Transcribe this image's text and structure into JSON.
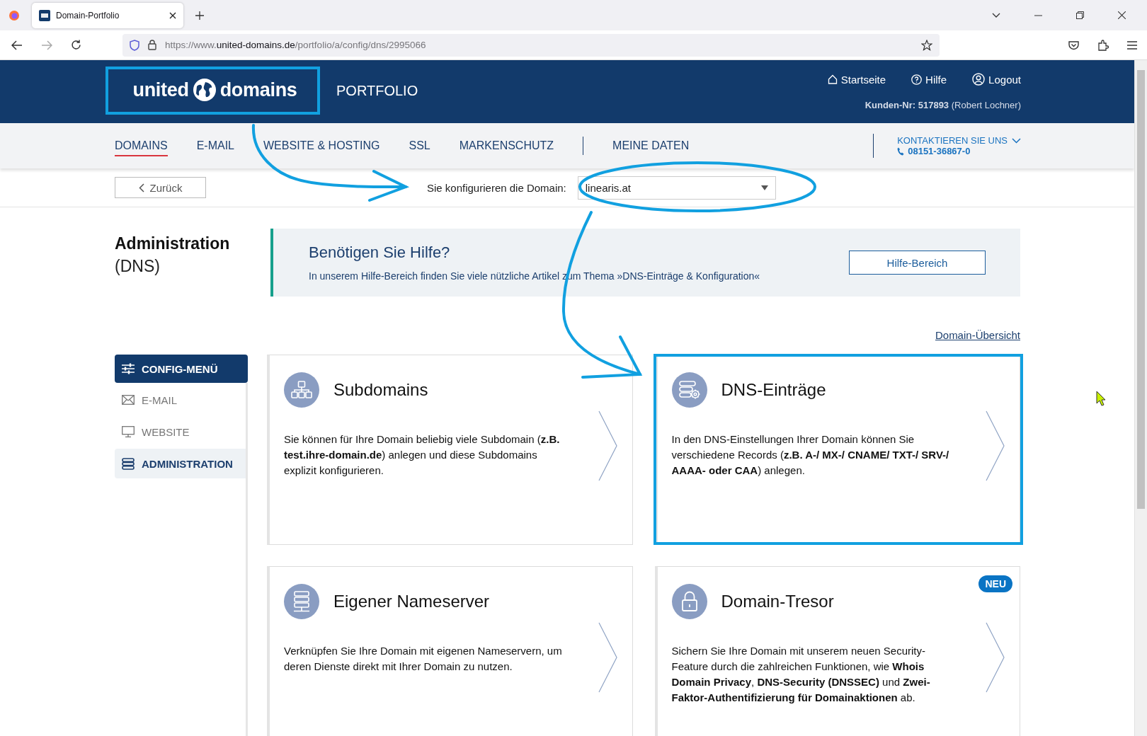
{
  "browser": {
    "tab_title": "Domain-Portfolio",
    "url_prefix": "https://www.",
    "url_host": "united-domains.de",
    "url_path": "/portfolio/a/config/dns/2995066"
  },
  "header": {
    "logo_left": "united",
    "logo_right": "domains",
    "section": "PORTFOLIO",
    "links": [
      {
        "label": "Startseite",
        "kind": "home"
      },
      {
        "label": "Hilfe",
        "kind": "help"
      },
      {
        "label": "Logout",
        "kind": "user"
      }
    ],
    "customer": "**Kunden-Nr: 517893** (Robert Lochner)"
  },
  "nav": {
    "items": [
      {
        "label": "DOMAINS",
        "selected": true
      },
      {
        "label": "E-MAIL",
        "selected": false
      },
      {
        "label": "WEBSITE & HOSTING",
        "selected": false
      },
      {
        "label": "SSL",
        "selected": false
      },
      {
        "label": "MARKENSCHUTZ",
        "selected": false
      }
    ],
    "secondary": [
      {
        "label": "MEINE DATEN",
        "selected": false
      }
    ],
    "contact": {
      "label": "KONTAKTIEREN SIE UNS",
      "phone": "08151-36867-0"
    }
  },
  "subbar": {
    "back": "Zurück",
    "domain_label": "Sie konfigurieren die Domain:",
    "domain_value": "linearis.at"
  },
  "page_title": {
    "title": "Administration",
    "subtitle": "(DNS)"
  },
  "help": {
    "title": "Benötigen Sie Hilfe?",
    "text": "In unserem Hilfe-Bereich finden Sie viele nützliche Artikel zum Thema »DNS-Einträge & Konfiguration«",
    "button": "Hilfe-Bereich"
  },
  "overview_link": "Domain-Übersicht",
  "sidebar": {
    "header": "CONFIG-MENÜ",
    "items": [
      {
        "label": "E-MAIL",
        "kind": "mail",
        "selected": false
      },
      {
        "label": "WEBSITE",
        "kind": "monitor",
        "selected": false
      },
      {
        "label": "ADMINISTRATION",
        "kind": "stack",
        "selected": true
      }
    ]
  },
  "cards": [
    {
      "title": "Subdomains",
      "kind": "tree",
      "text": "Sie können für Ihre Domain beliebig viele Subdomain (**z.B. test.ihre-domain.de**) anlegen und diese Subdomains explizit konfigurieren."
    },
    {
      "title": "DNS-Einträge",
      "kind": "server-gear",
      "text": "In den DNS-Einstellungen Ihrer Domain können Sie verschiedene Records (**z.B. A-/ MX-/ CNAME/ TXT-/ SRV-/ AAAA- oder CAA**) anlegen."
    },
    {
      "title": "Eigener Nameserver",
      "kind": "server",
      "text": "Verknüpfen Sie Ihre Domain mit eigenen Nameservern, um deren Dienste direkt mit Ihrer Domain zu nutzen."
    },
    {
      "title": "Domain-Tresor",
      "kind": "lock",
      "new": true,
      "text": "Sichern Sie Ihre Domain mit unserem neuen Security-Feature durch die zahlreichen Funktionen, wie **Whois Domain Privacy**, **DNS-Security (DNSSEC)** und **Zwei-Faktor-Authentifizierung für Domainaktionen** ab."
    }
  ],
  "new_badge": "NEU"
}
